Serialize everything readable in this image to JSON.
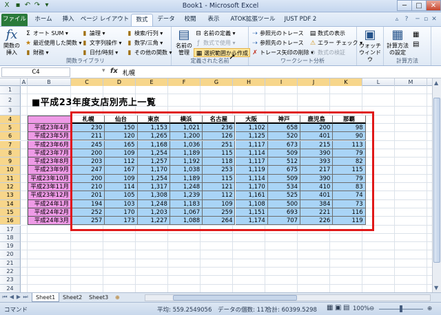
{
  "window": {
    "title": "Book1 - Microsoft Excel",
    "controls": {
      "minimize": "─",
      "maximize": "□",
      "close": "✕"
    }
  },
  "tabs": [
    {
      "label": "ファイル",
      "file": true
    },
    {
      "label": "ホーム"
    },
    {
      "label": "挿入"
    },
    {
      "label": "ページ レイアウト"
    },
    {
      "label": "数式",
      "active": true
    },
    {
      "label": "データ"
    },
    {
      "label": "校閲"
    },
    {
      "label": "表示"
    },
    {
      "label": "ATOK拡張ツール"
    },
    {
      "label": "JUST PDF 2"
    }
  ],
  "ribbon": {
    "insert_function": "関数の\n挿入",
    "function_library": {
      "label": "関数ライブラリ",
      "autosum": "オート SUM",
      "recent": "最近使用した関数",
      "financial": "財務",
      "logical": "論理",
      "text": "文字列操作",
      "datetime": "日付/時刻",
      "lookup": "検索/行列",
      "math": "数学/三角",
      "other": "その他の関数"
    },
    "defined_names": {
      "label": "定義された名前",
      "name_manager": "名前の\n管理",
      "define_name": "名前の定義",
      "use_in_formula": "数式で使用",
      "create_from_selection": "選択範囲から作成"
    },
    "formula_auditing": {
      "label": "ワークシート分析",
      "trace_precedents": "参照元のトレース",
      "trace_dependents": "参照先のトレース",
      "remove_arrows": "トレース矢印の削除",
      "show_formulas": "数式の表示",
      "error_checking": "エラー チェック",
      "evaluate_formula": "数式の検証",
      "watch_window": "ウォッチ\nウィンドウ"
    },
    "calculation": {
      "label": "計算方法",
      "calc_options": "計算方法\nの設定"
    }
  },
  "formula_bar": {
    "name_box": "C4",
    "fx": "fx",
    "content": "札幌"
  },
  "columns": [
    "A",
    "B",
    "C",
    "D",
    "E",
    "F",
    "G",
    "H",
    "I",
    "J",
    "K",
    "L",
    "M"
  ],
  "selected_columns": [
    "C",
    "D",
    "E",
    "F",
    "G",
    "H",
    "I",
    "J",
    "K"
  ],
  "rows": [
    "1",
    "2",
    "3",
    "4",
    "5",
    "6",
    "7",
    "8",
    "9",
    "10",
    "11",
    "12",
    "13",
    "14",
    "15",
    "16",
    "17",
    "18",
    "19",
    "20",
    "21",
    "22",
    "23",
    "24"
  ],
  "selected_rows": [
    "4",
    "5",
    "6",
    "7",
    "8",
    "9",
    "10",
    "11",
    "12",
    "13",
    "14",
    "15",
    "16"
  ],
  "sheet_title": "■平成23年度支店別売上一覧",
  "table": {
    "headers": [
      "札幌",
      "仙台",
      "東京",
      "横浜",
      "名古屋",
      "大阪",
      "神戸",
      "鹿児島",
      "那覇"
    ],
    "row_labels": [
      "平成23年4月",
      "平成23年5月",
      "平成23年6月",
      "平成23年7月",
      "平成23年8月",
      "平成23年9月",
      "平成23年10月",
      "平成23年11月",
      "平成23年12月",
      "平成24年1月",
      "平成24年2月",
      "平成24年3月"
    ],
    "values": [
      [
        "230",
        "150",
        "1,153",
        "1,021",
        "236",
        "1,102",
        "658",
        "200",
        "98"
      ],
      [
        "211",
        "120",
        "1,265",
        "1,200",
        "126",
        "1,125",
        "520",
        "401",
        "90"
      ],
      [
        "245",
        "165",
        "1,168",
        "1,036",
        "251",
        "1,117",
        "673",
        "215",
        "113"
      ],
      [
        "200",
        "109",
        "1,254",
        "1,189",
        "115",
        "1,114",
        "509",
        "390",
        "79"
      ],
      [
        "203",
        "112",
        "1,257",
        "1,192",
        "118",
        "1,117",
        "512",
        "393",
        "82"
      ],
      [
        "247",
        "167",
        "1,170",
        "1,038",
        "253",
        "1,119",
        "675",
        "217",
        "115"
      ],
      [
        "200",
        "109",
        "1,254",
        "1,189",
        "115",
        "1,114",
        "509",
        "390",
        "79"
      ],
      [
        "210",
        "114",
        "1,317",
        "1,248",
        "121",
        "1,170",
        "534",
        "410",
        "83"
      ],
      [
        "201",
        "105",
        "1,308",
        "1,239",
        "112",
        "1,161",
        "525",
        "401",
        "74"
      ],
      [
        "194",
        "103",
        "1,248",
        "1,183",
        "109",
        "1,108",
        "500",
        "384",
        "73"
      ],
      [
        "252",
        "170",
        "1,203",
        "1,067",
        "259",
        "1,151",
        "693",
        "221",
        "116"
      ],
      [
        "257",
        "173",
        "1,227",
        "1,088",
        "264",
        "1,174",
        "707",
        "226",
        "119"
      ]
    ]
  },
  "sheet_tabs": [
    "Sheet1",
    "Sheet2",
    "Sheet3"
  ],
  "status": {
    "mode": "コマンド",
    "average": "平均: 559.2549056",
    "count": "データの個数: 117",
    "sum": "合計: 60399.5298",
    "zoom": "100%"
  }
}
